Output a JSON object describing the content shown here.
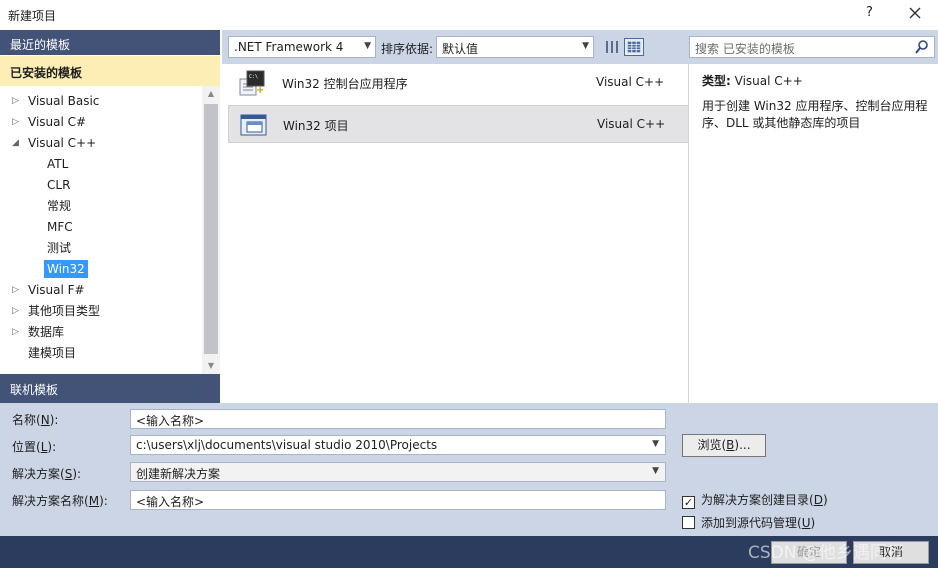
{
  "window": {
    "title": "新建项目",
    "help": "?",
    "close_icon": "close-icon"
  },
  "left": {
    "recent_header": "最近的模板",
    "installed_header": "已安装的模板",
    "online_header": "联机模板",
    "tree": [
      {
        "label": "Visual Basic",
        "expander": "▷"
      },
      {
        "label": "Visual C#",
        "expander": "▷"
      },
      {
        "label": "Visual C++",
        "expander": "◢"
      },
      {
        "label": "ATL",
        "expander": ""
      },
      {
        "label": "CLR",
        "expander": ""
      },
      {
        "label": "常规",
        "expander": ""
      },
      {
        "label": "MFC",
        "expander": ""
      },
      {
        "label": "测试",
        "expander": ""
      },
      {
        "label": "Win32",
        "expander": "",
        "selected": true
      },
      {
        "label": "Visual F#",
        "expander": "▷"
      },
      {
        "label": "其他项目类型",
        "expander": "▷"
      },
      {
        "label": "数据库",
        "expander": "▷"
      },
      {
        "label": "建模项目",
        "expander": ""
      }
    ]
  },
  "toolbar": {
    "framework": ".NET Framework 4",
    "sort_label": "排序依据:",
    "sort_value": "默认值",
    "search_placeholder": "搜索 已安装的模板"
  },
  "templates": [
    {
      "name": "Win32 控制台应用程序",
      "lang": "Visual C++",
      "icon": "console-app-icon"
    },
    {
      "name": "Win32 项目",
      "lang": "Visual C++",
      "icon": "win32-project-icon",
      "selected": true
    }
  ],
  "detail": {
    "type_label": "类型:",
    "type_value": "Visual C++",
    "description": "用于创建 Win32 应用程序、控制台应用程序、DLL 或其他静态库的项目"
  },
  "form": {
    "name_label": "名称",
    "name_key": "N",
    "name_value": "<输入名称>",
    "location_label": "位置",
    "location_key": "L",
    "location_value": "c:\\users\\xlj\\documents\\visual studio 2010\\Projects",
    "browse_label": "浏览",
    "browse_key": "B",
    "solution_label": "解决方案",
    "solution_key": "S",
    "solution_value": "创建新解决方案",
    "solution_name_label": "解决方案名称",
    "solution_name_key": "M",
    "solution_name_value": "<输入名称>",
    "create_dir_label": "为解决方案创建目录",
    "create_dir_key": "D",
    "create_dir_checked": true,
    "source_control_label": "添加到源代码管理",
    "source_control_key": "U",
    "source_control_checked": false
  },
  "footer": {
    "ok": "确定",
    "cancel": "取消",
    "watermark": "CSDN @他乡遇同行"
  }
}
